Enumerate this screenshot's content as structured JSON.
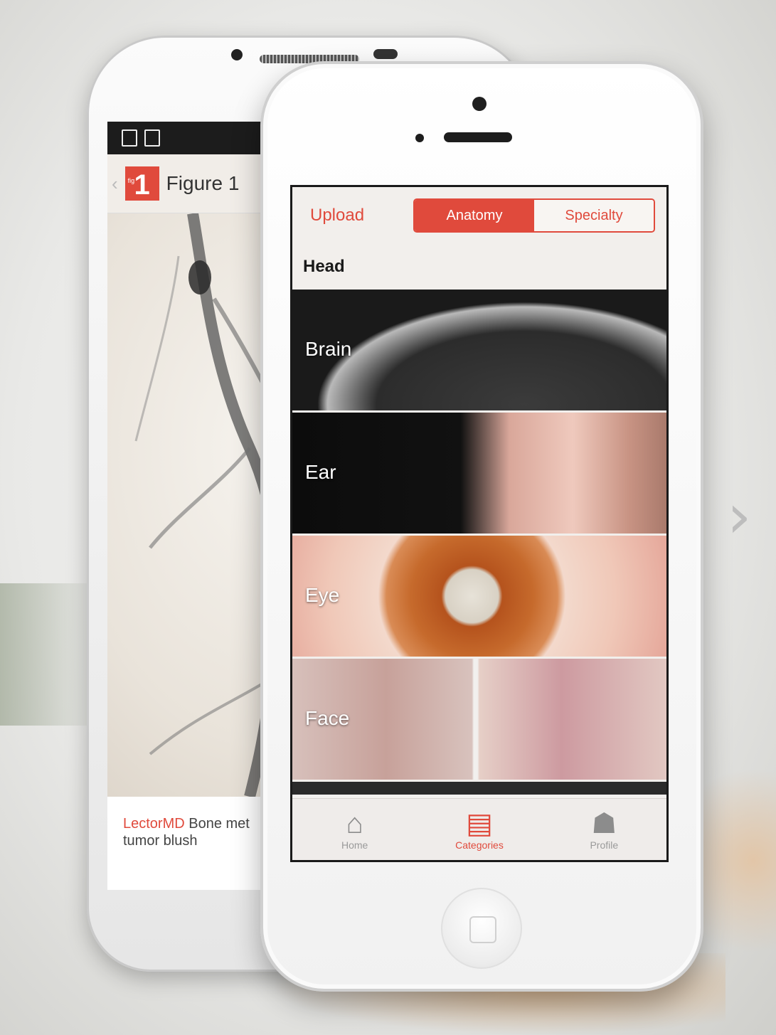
{
  "android": {
    "actionbar": {
      "logo_text": "1",
      "logo_sub": "fig",
      "title": "Figure 1"
    },
    "caption": {
      "brand": "LectorMD",
      "text_line1": " Bone met",
      "text_line2": "tumor blush"
    }
  },
  "iphone": {
    "topbar": {
      "upload_label": "Upload",
      "tabs": [
        {
          "label": "Anatomy",
          "active": true
        },
        {
          "label": "Specialty",
          "active": false
        }
      ]
    },
    "section_title": "Head",
    "tiles": [
      {
        "label": "Brain"
      },
      {
        "label": "Ear"
      },
      {
        "label": "Eye"
      },
      {
        "label": "Face"
      }
    ],
    "tabbar": [
      {
        "label": "Home",
        "icon": "home-icon",
        "active": false
      },
      {
        "label": "Categories",
        "icon": "categories-icon",
        "active": true
      },
      {
        "label": "Profile",
        "icon": "profile-icon",
        "active": false
      }
    ]
  },
  "nav": {
    "next_icon": "chevron-right-icon"
  },
  "colors": {
    "accent": "#e04a3c",
    "tab_inactive": "#9a9a9a"
  }
}
